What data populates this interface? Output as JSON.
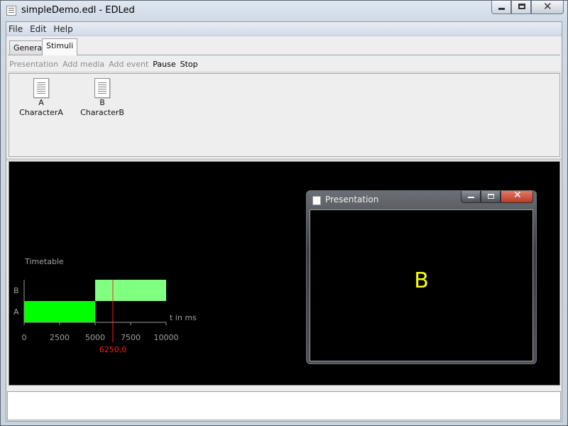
{
  "window": {
    "title": "simpleDemo.edl - EDLed"
  },
  "menu": [
    "File",
    "Edit",
    "Help"
  ],
  "tabs": [
    {
      "label": "General",
      "active": false
    },
    {
      "label": "Stimuli",
      "active": true
    }
  ],
  "toolbar": {
    "presentation": "Presentation",
    "add_media": "Add media",
    "add_event": "Add event",
    "pause": "Pause",
    "stop": "Stop"
  },
  "stimuli": [
    {
      "id": "A",
      "name": "CharacterA"
    },
    {
      "id": "B",
      "name": "CharacterB"
    }
  ],
  "timetable": {
    "label": "Timetable",
    "x_axis_label": "t in ms",
    "rows": [
      "A",
      "B"
    ],
    "ticks": [
      "0",
      "2500",
      "5000",
      "7500",
      "10000"
    ],
    "events": [
      {
        "row": "A",
        "start": 0,
        "end": 5000,
        "color": "#00ff00"
      },
      {
        "row": "B",
        "start": 5000,
        "end": 10000,
        "color": "#80ff80"
      }
    ],
    "cursor_value": 6250,
    "cursor_label": "6250,0",
    "cursor_color": "#ff2020"
  },
  "presentation_window": {
    "title": "Presentation",
    "display_text": "B",
    "display_color": "#ffff00"
  },
  "icons": {
    "app": "document-icon",
    "stimulus": "document-icon"
  }
}
